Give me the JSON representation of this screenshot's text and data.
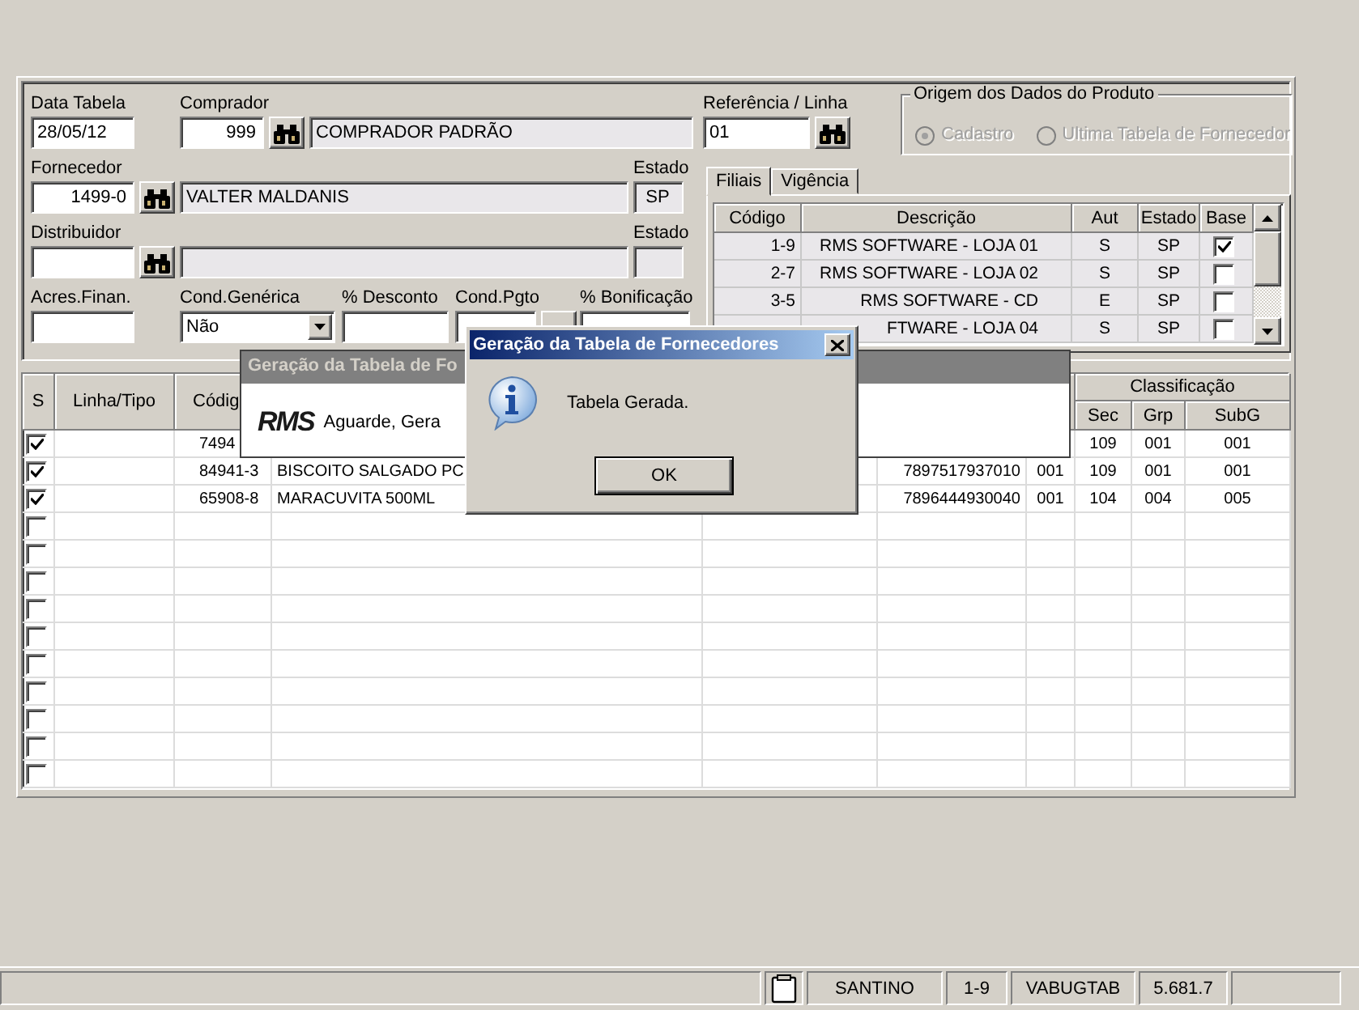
{
  "form": {
    "data_tabela": {
      "label": "Data Tabela",
      "value": "28/05/12"
    },
    "comprador": {
      "label": "Comprador",
      "code": "999",
      "name": "COMPRADOR PADRÃO"
    },
    "fornecedor": {
      "label": "Fornecedor",
      "code": "1499-0",
      "name": "VALTER MALDANIS",
      "estado_label": "Estado",
      "estado": "SP"
    },
    "distribuidor": {
      "label": "Distribuidor",
      "estado_label": "Estado"
    },
    "acres_finan": {
      "label": "Acres.Finan."
    },
    "cond_generica": {
      "label": "Cond.Genérica",
      "value": "Não"
    },
    "desconto": {
      "label": "% Desconto"
    },
    "cond_pgto": {
      "label": "Cond.Pgto"
    },
    "bonificacao": {
      "label": "% Bonificação"
    },
    "referencia_linha": {
      "label": "Referência / Linha",
      "value": "01"
    },
    "origem": {
      "title": "Origem dos Dados do Produto",
      "disabled": true,
      "options": [
        {
          "label": "Cadastro",
          "selected": true
        },
        {
          "label": "Ultima Tabela de Fornecedor",
          "selected": false
        }
      ]
    }
  },
  "tabs": [
    {
      "label": "Filiais",
      "selected": true
    },
    {
      "label": "Vigência",
      "selected": false
    }
  ],
  "filiais": {
    "columns": [
      "Código",
      "Descrição",
      "Aut",
      "Estado",
      "Base"
    ],
    "rows": [
      {
        "codigo": "1-9",
        "descricao": "RMS SOFTWARE - LOJA 01",
        "aut": "S",
        "estado": "SP",
        "base": true
      },
      {
        "codigo": "2-7",
        "descricao": "RMS SOFTWARE - LOJA 02",
        "aut": "S",
        "estado": "SP",
        "base": false
      },
      {
        "codigo": "3-5",
        "descricao": "RMS SOFTWARE - CD",
        "aut": "E",
        "estado": "SP",
        "base": false
      },
      {
        "descricao": "FTWARE - LOJA 04",
        "aut": "S",
        "estado": "SP",
        "base": false
      }
    ]
  },
  "products": {
    "headers": [
      "S",
      "Linha/Tipo",
      "Códig"
    ],
    "group_header": "Classificação",
    "sub_headers": [
      "Sec",
      "Grp",
      "SubG"
    ],
    "rows": [
      {
        "checked": true,
        "codigo": "7494",
        "sec": "109",
        "grp": "001",
        "subg": "001"
      },
      {
        "checked": true,
        "codigo": "84941-3",
        "descricao": "BISCOITO SALGADO PC",
        "column_5": "7897517937010",
        "column_6": "001",
        "sec": "109",
        "grp": "001",
        "subg": "001"
      },
      {
        "checked": true,
        "codigo": "65908-8",
        "descricao": "MARACUVITA 500ML",
        "column_5": "7896444930040",
        "column_6": "001",
        "sec": "104",
        "grp": "004",
        "subg": "005"
      },
      {
        "checked": false
      },
      {
        "checked": false
      },
      {
        "checked": false
      },
      {
        "checked": false
      },
      {
        "checked": false
      },
      {
        "checked": false
      },
      {
        "checked": false
      },
      {
        "checked": false
      },
      {
        "checked": false
      },
      {
        "checked": false
      }
    ]
  },
  "progress_dialog": {
    "title": "Geração da Tabela de Fo",
    "logo": "RMS",
    "message": "Aguarde, Gera"
  },
  "message_dialog": {
    "title": "Geração da Tabela de Fornecedores",
    "message": "Tabela Gerada.",
    "button": "OK"
  },
  "status_bar": [
    "SANTINO",
    "1-9",
    "VABUGTAB",
    "5.681.7"
  ]
}
